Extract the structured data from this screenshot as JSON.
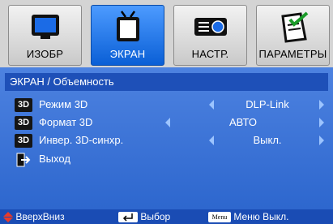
{
  "tabs": [
    {
      "label": "ИЗОБР",
      "icon": "monitor-icon",
      "active": false
    },
    {
      "label": "ЭКРАН",
      "icon": "projector-screen-icon",
      "active": true
    },
    {
      "label": "НАСТР.",
      "icon": "projector-icon",
      "active": false
    },
    {
      "label": "ПАРАМЕТРЫ",
      "icon": "checklist-icon",
      "active": false
    }
  ],
  "panel": {
    "title": "ЭКРАН / Объемность",
    "rows": [
      {
        "icon_text": "3D",
        "label": "Режим 3D",
        "value": "DLP-Link"
      },
      {
        "icon_text": "3D",
        "label": "Формат 3D",
        "value": "АВТО"
      },
      {
        "icon_text": "3D",
        "label": "Инвер. 3D-синхр.",
        "value": "Выкл."
      }
    ],
    "exit_label": "Выход"
  },
  "footer": {
    "nav_label": "ВверхВниз",
    "select_label": "Выбор",
    "menu_key": "Menu",
    "menu_label": "Меню Выкл."
  },
  "colors": {
    "accent": "#0a5fd6",
    "panel": "#2a64cc",
    "arrow": "#9cc4ff"
  }
}
